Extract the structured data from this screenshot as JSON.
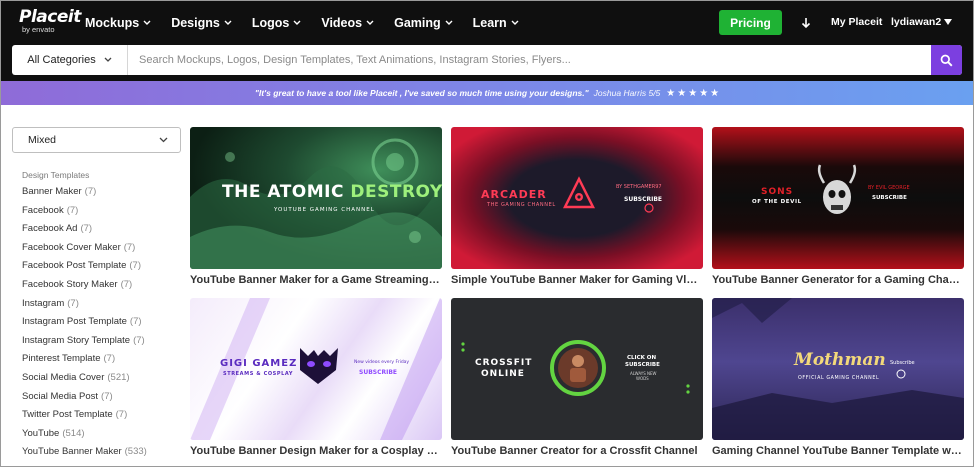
{
  "nav": {
    "logo_brand": "Placeit",
    "logo_by": "by envato",
    "items": [
      {
        "label": "Mockups"
      },
      {
        "label": "Designs"
      },
      {
        "label": "Logos"
      },
      {
        "label": "Videos"
      },
      {
        "label": "Gaming"
      },
      {
        "label": "Learn"
      }
    ],
    "pricing_label": "Pricing",
    "my_placeit": "My Placeit",
    "username": "lydiawan2",
    "pricing_color": "#1fb234"
  },
  "search": {
    "category": "All Categories",
    "placeholder": "Search Mockups, Logos, Design Templates, Text Animations, Instagram Stories, Flyers...",
    "button_color": "#7c3fe0"
  },
  "testimonial": {
    "quote": "\"It's great to have a tool like Placeit , I've saved so much time using your designs.\"",
    "author": "Joshua Harris 5/5",
    "stars": "★★★★★"
  },
  "sidebar": {
    "sort": "Mixed",
    "heading": "Design Templates",
    "items": [
      {
        "label": "Banner Maker",
        "count": "(7)"
      },
      {
        "label": "Facebook",
        "count": "(7)"
      },
      {
        "label": "Facebook Ad",
        "count": "(7)"
      },
      {
        "label": "Facebook Cover Maker",
        "count": "(7)"
      },
      {
        "label": "Facebook Post Template",
        "count": "(7)"
      },
      {
        "label": "Facebook Story Maker",
        "count": "(7)"
      },
      {
        "label": "Instagram",
        "count": "(7)"
      },
      {
        "label": "Instagram Post Template",
        "count": "(7)"
      },
      {
        "label": "Instagram Story Template",
        "count": "(7)"
      },
      {
        "label": "Pinterest Template",
        "count": "(7)"
      },
      {
        "label": "Social Media Cover",
        "count": "(521)"
      },
      {
        "label": "Social Media Post",
        "count": "(7)"
      },
      {
        "label": "Twitter Post Template",
        "count": "(7)"
      },
      {
        "label": "YouTube",
        "count": "(514)"
      },
      {
        "label": "YouTube Banner Maker",
        "count": "(533)"
      }
    ]
  },
  "cards": [
    {
      "title": "YouTube Banner Maker for a Game Streaming Channel",
      "thumb": {
        "headline_a": "THE ATOMIC ",
        "headline_b": "DESTROYER",
        "sub": "YOUTUBE GAMING CHANNEL"
      }
    },
    {
      "title": "Simple YouTube Banner Maker for Gaming Vloggers",
      "thumb": {
        "headline": "ARCADER",
        "sub": "THE GAMING CHANNEL",
        "by": "BY SETHGAMER97",
        "cta": "SUBSCRIBE"
      }
    },
    {
      "title": "YouTube Banner Generator for a Gaming Channel with a Skull",
      "thumb": {
        "headline": "SONS",
        "sub": "OF THE DEVIL",
        "by": "BY EVIL GEORGE",
        "cta": "SUBSCRIBE"
      }
    },
    {
      "title": "YouTube Banner Design Maker for a Cosplay Channel",
      "thumb": {
        "headline": "GIGI GAMEZ",
        "sub": "STREAMS & COSPLAY",
        "note": "New videos every Friday",
        "cta": "SUBSCRIBE"
      }
    },
    {
      "title": "YouTube Banner Creator for a Crossfit Channel",
      "thumb": {
        "headline": "CROSSFIT",
        "headline2": "ONLINE",
        "cta1": "CLICK ON",
        "cta2": "SUBSCRIBE",
        "cta3": "ALWAYS NEW",
        "cta4": "WODS"
      }
    },
    {
      "title": "Gaming Channel YouTube Banner Template with a Mothman",
      "thumb": {
        "headline": "Mothman",
        "sub": "OFFICIAL GAMING CHANNEL",
        "cta": "Subscribe"
      }
    }
  ]
}
